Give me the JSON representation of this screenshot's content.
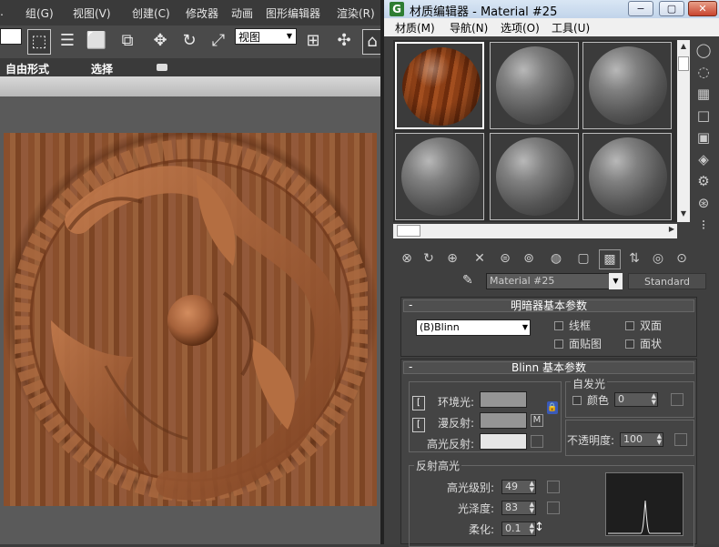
{
  "main": {
    "menu": [
      "组(G)",
      "视图(V)",
      "创建(C)",
      "修改器",
      "动画",
      "图形编辑器",
      "渲染(R)"
    ],
    "view_select": "视图",
    "ribbon": {
      "freeform": "自由形式",
      "select": "选择"
    }
  },
  "editor": {
    "title": "材质编辑器 - Material #25",
    "menu": [
      "材质(M)",
      "导航(N)",
      "选项(O)",
      "工具(U)"
    ],
    "material_name": "Material #25",
    "material_type": "Standard",
    "shader_panel": {
      "title": "明暗器基本参数",
      "shader": "(B)Blinn",
      "wire": "线框",
      "two_sided": "双面",
      "face_map": "面贴图",
      "faceted": "面状"
    },
    "blinn_panel": {
      "title": "Blinn 基本参数",
      "ambient": "环境光:",
      "diffuse": "漫反射:",
      "specular": "高光反射:",
      "map_button": "M",
      "self_illum": "自发光",
      "color_label": "颜色",
      "self_illum_value": "0",
      "opacity_label": "不透明度:",
      "opacity_value": "100",
      "ambient_color": "#959595",
      "diffuse_color": "#959595",
      "specular_color": "#e6e6e6"
    },
    "highlight": {
      "title": "反射高光",
      "level_label": "高光级别:",
      "level_value": "49",
      "gloss_label": "光泽度:",
      "gloss_value": "83",
      "soften_label": "柔化:",
      "soften_value": "0.1"
    }
  }
}
